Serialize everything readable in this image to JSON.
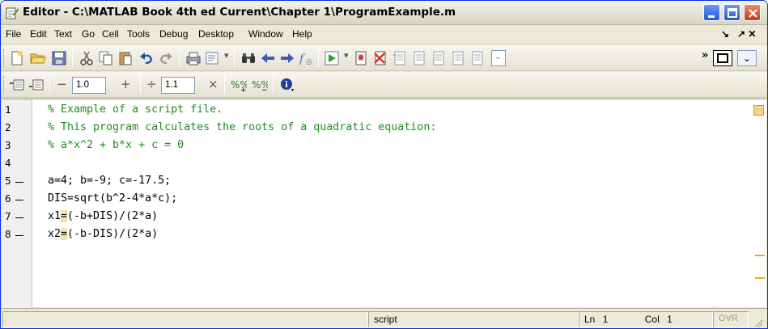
{
  "window": {
    "title": "Editor - C:\\MATLAB Book 4th ed Current\\Chapter 1\\ProgramExample.m"
  },
  "menu": {
    "items": [
      "File",
      "Edit",
      "Text",
      "Go",
      "Cell",
      "Tools",
      "Debug",
      "Desktop",
      "Window",
      "Help"
    ],
    "right": [
      "↘",
      "↗ ✕"
    ]
  },
  "toolbar2": {
    "minus_symbol": "−",
    "field1_value": "1.0",
    "plus_symbol": "+",
    "divide_symbol": "÷",
    "field2_value": "1.1",
    "times_symbol": "×"
  },
  "editor": {
    "line_numbers": [
      "1",
      "2",
      "3",
      "4",
      "5",
      "6",
      "7",
      "8"
    ],
    "lines": [
      {
        "type": "comment",
        "text": "% Example of a script file."
      },
      {
        "type": "comment",
        "text": "% This program calculates the roots of a quadratic equation:"
      },
      {
        "type": "comment",
        "text": "% a*x^2 + b*x + c = 0"
      },
      {
        "type": "code",
        "text": ""
      },
      {
        "type": "code",
        "text": "a=4; b=-9; c=-17.5;"
      },
      {
        "type": "code",
        "text": "DIS=sqrt(b^2-4*a*c);"
      },
      {
        "type": "code",
        "pre": "x1",
        "eq": "=",
        "post": "(-b+DIS)/(2*a)"
      },
      {
        "type": "code",
        "pre": "x2",
        "eq": "=",
        "post": "(-b-DIS)/(2*a)"
      }
    ]
  },
  "statusbar": {
    "mode": "script",
    "ln_label": "Ln",
    "ln_value": "1",
    "col_label": "Col",
    "col_value": "1",
    "ovr": "OVR"
  },
  "colors": {
    "comment": "#228b22",
    "title_accent": "#0831d9",
    "marker": "#f0a030"
  }
}
